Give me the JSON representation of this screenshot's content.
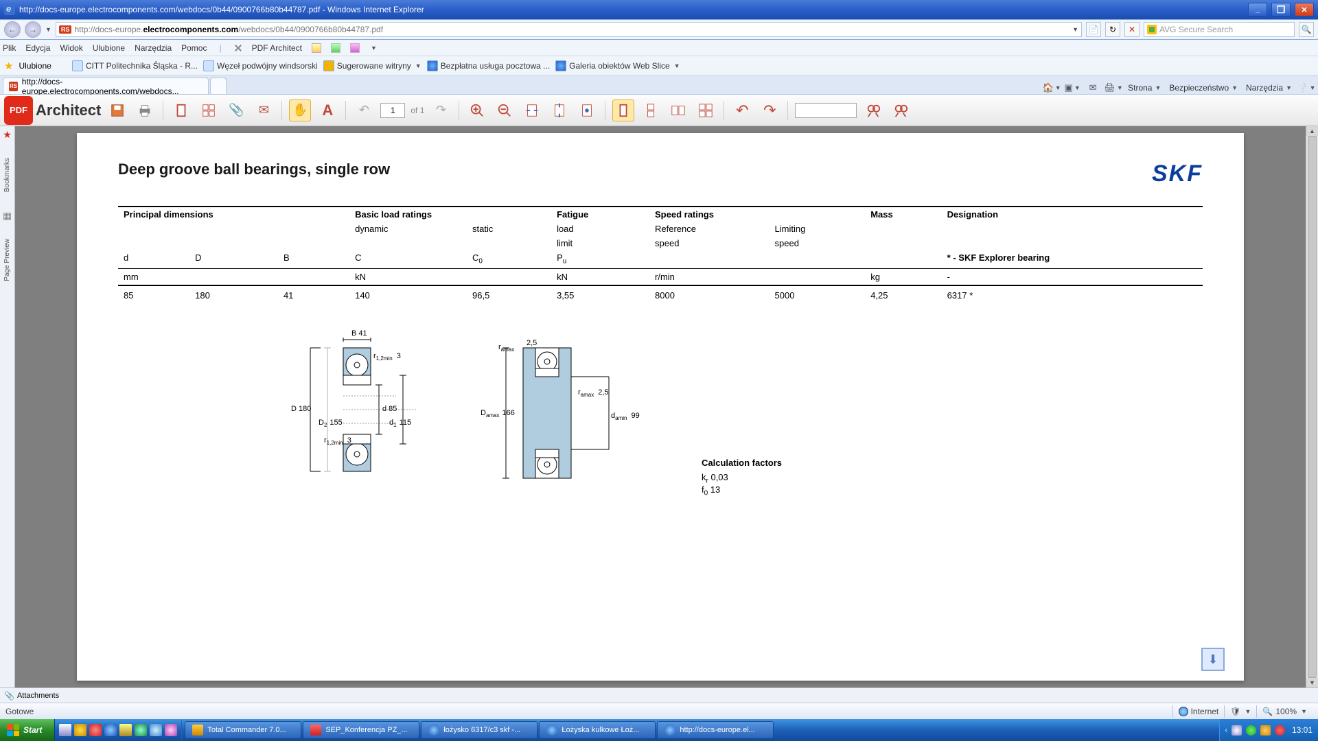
{
  "window": {
    "title": "http://docs-europe.electrocomponents.com/webdocs/0b44/0900766b80b44787.pdf - Windows Internet Explorer",
    "minimize": "_",
    "maximize": "❐",
    "close": "✕"
  },
  "addr": {
    "pre": "http://docs-europe.",
    "host": "electrocomponents.com",
    "post": "/webdocs/0b44/0900766b80b44787.pdf",
    "search_placeholder": "AVG Secure Search"
  },
  "menu": {
    "items": [
      "Plik",
      "Edycja",
      "Widok",
      "Ulubione",
      "Narzędzia",
      "Pomoc"
    ],
    "pdf_architect": "PDF Architect"
  },
  "favorites": {
    "label": "Ulubione",
    "items": [
      {
        "label": "CITT Politechnika Śląska - R..."
      },
      {
        "label": "Węzeł podwójny windsorski"
      },
      {
        "label": "Sugerowane witryny"
      },
      {
        "label": "Bezpłatna usługa pocztowa ..."
      },
      {
        "label": "Galeria obiektów Web Slice"
      }
    ]
  },
  "tab": {
    "title": "http://docs-europe.electrocomponents.com/webdocs..."
  },
  "tab_tools": {
    "page": "Strona",
    "safety": "Bezpieczeństwo",
    "tools": "Narzędzia"
  },
  "pdf_toolbar": {
    "logo": "Architect",
    "page": "1",
    "of": "of 1"
  },
  "sidebar": {
    "bookmarks": "Bookmarks",
    "page_preview": "Page Preview"
  },
  "attachments": "Attachments",
  "statusbar": {
    "ready": "Gotowe",
    "zone": "Internet",
    "zoom": "100%"
  },
  "taskbar": {
    "start": "Start",
    "tasks": [
      {
        "label": "Total Commander 7.0..."
      },
      {
        "label": "SEP_Konferencja PZ_..."
      },
      {
        "label": "łożysko 6317/c3 skf -..."
      },
      {
        "label": "Łożyska kulkowe Łoż..."
      },
      {
        "label": "http://docs-europe.el..."
      }
    ],
    "clock": "13:01"
  },
  "doc": {
    "title": "Deep groove ball bearings, single row",
    "skf": "SKF",
    "headers": {
      "principal": "Principal dimensions",
      "basic": "Basic load ratings",
      "dynamic": "dynamic",
      "static": "static",
      "fatigue": "Fatigue",
      "load": "load",
      "limit": "limit",
      "speed": "Speed ratings",
      "reference": "Reference",
      "ref_speed": "speed",
      "limiting": "Limiting",
      "lim_speed": "speed",
      "mass": "Mass",
      "designation": "Designation",
      "explorer": "* - SKF Explorer bearing",
      "d": "d",
      "D": "D",
      "B": "B",
      "C": "C",
      "C0": "C",
      "C0sub": "0",
      "Pu": "P",
      "Pusub": "u",
      "mm": "mm",
      "kN": "kN",
      "kN2": "kN",
      "rmin": "r/min",
      "kg": "kg",
      "dash": "-"
    },
    "row": {
      "d": "85",
      "D": "180",
      "B": "41",
      "C": "140",
      "C0": "96,5",
      "Pu": "3,55",
      "ref": "8000",
      "lim": "5000",
      "mass": "4,25",
      "desig": "6317 *"
    },
    "diag1": {
      "B": "B 41",
      "r12min_t": "1,2min",
      "r_val_t": "3",
      "D": "D 180",
      "d": "d 85",
      "D2": "D",
      "D2sub": "2",
      "D2val": "155",
      "d1": "d",
      "d1sub": "1",
      "d1val": "115",
      "r12min_b": "1,2min",
      "r_val_b": "3",
      "r_pre": "r"
    },
    "diag2": {
      "ramax_t": "amax",
      "ramax_t_val": "2,5",
      "r_pre": "r",
      "Damax": "D",
      "Damax_sub": "amax",
      "Damax_val": "166",
      "ramax_r": "amax",
      "ramax_r_val": "2,5",
      "damin": "d",
      "damin_sub": "amin",
      "damin_val": "99"
    },
    "calc": {
      "title": "Calculation factors",
      "kr": "k",
      "kr_sub": "r",
      "kr_val": "0,03",
      "f0": "f",
      "f0_sub": "0",
      "f0_val": "13"
    }
  }
}
